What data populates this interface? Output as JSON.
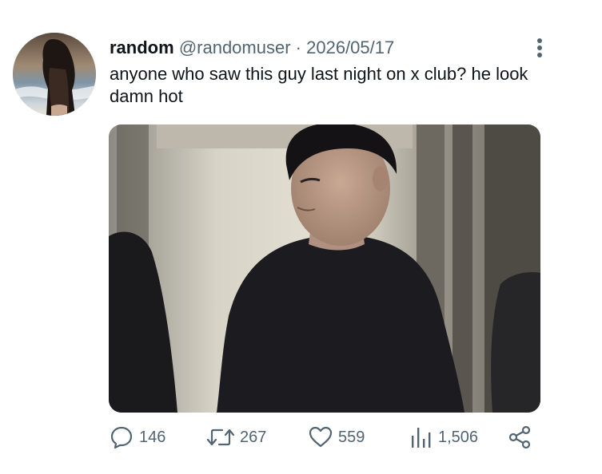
{
  "tweet": {
    "display_name": "random",
    "handle": "@randomuser",
    "separator": "·",
    "date": "2026/05/17",
    "text": "anyone who saw this guy last night on x club? he look damn hot",
    "avatar_icon": "profile-photo",
    "media_icon": "photo-attachment"
  },
  "actions": {
    "reply": {
      "icon": "reply-icon",
      "count": "146"
    },
    "retweet": {
      "icon": "retweet-icon",
      "count": "267"
    },
    "like": {
      "icon": "heart-icon",
      "count": "559"
    },
    "views": {
      "icon": "views-chart-icon",
      "count": "1,506"
    },
    "share": {
      "icon": "share-icon"
    }
  },
  "colors": {
    "text_primary": "#0f1419",
    "text_secondary": "#536471",
    "background": "#ffffff"
  }
}
